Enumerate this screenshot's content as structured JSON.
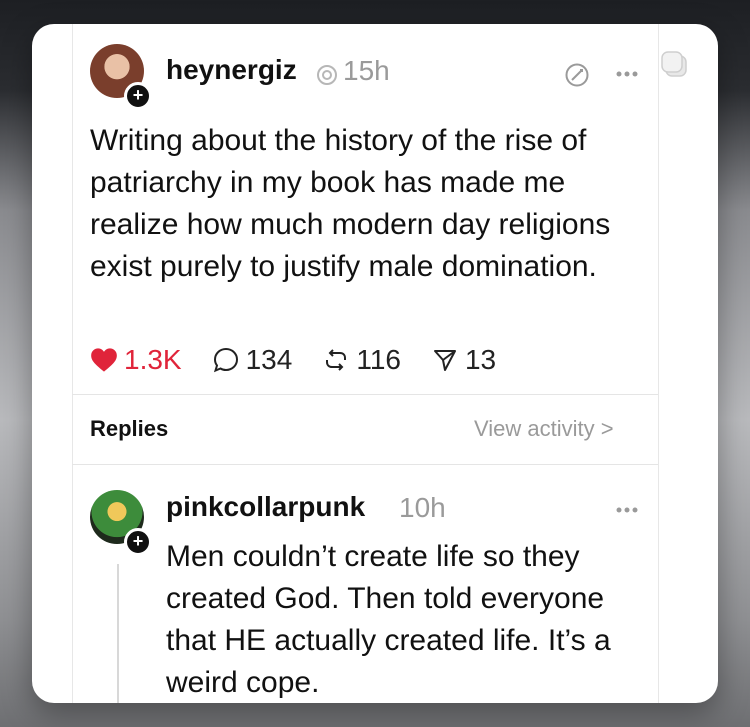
{
  "post": {
    "username": "heynergiz",
    "time": "15h",
    "text": "Writing about the history of the rise of patriarchy in my book has made me realize how much modern day religions exist purely to justify male domination.",
    "stats": {
      "likes": "1.3K",
      "comments": "134",
      "reposts": "116",
      "shares": "13"
    },
    "icons": [
      "plus-icon",
      "verified-icon",
      "edit-icon",
      "more-icon",
      "heart-icon",
      "comment-icon",
      "repost-icon",
      "share-icon"
    ]
  },
  "replies_bar": {
    "label": "Replies",
    "view_activity": "View activity >"
  },
  "reply": {
    "username": "pinkcollarpunk",
    "time": "10h",
    "text": "Men couldn’t create life so they created God. Then told everyone that HE actually created life. It’s a weird cope.",
    "icons": [
      "plus-icon",
      "more-icon"
    ]
  },
  "colors": {
    "like": "#e0243a",
    "muted": "#9a9a9a",
    "text": "#111111"
  }
}
